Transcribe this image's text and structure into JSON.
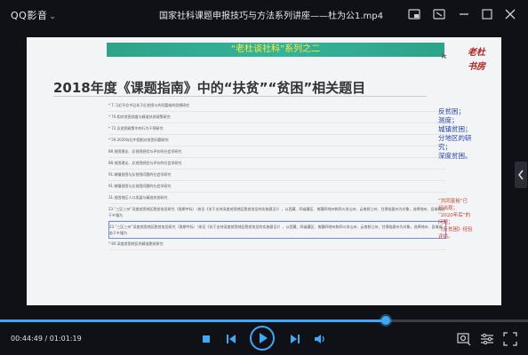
{
  "app": {
    "brand": "QQ影音",
    "window_title": "国家社科课题申报技巧与方法系列讲座——杜为公1.mp4"
  },
  "slide": {
    "banner": "“老杜谈社科”系列之二",
    "logo_text": "老杜书房",
    "heading": "2018年度《课题指南》中的“扶贫”“贫困”相关题目",
    "items": [
      "* 7.习近平总书记关于反贫困与共同富裕的思想研究",
      "* 70.相对贫困测度与精准扶贫政策研究",
      "* 72.反贫困政策中的行为干预研究",
      "* 59.2020年后中国相对贫困问题研究",
      "88.贫困理论、反贫困经验与评价的社会学研究",
      "88.贫困理论、反贫困经验与评价的社会学研究",
      "91.城镇贫困与反贫困问题的社会学研究",
      "91.城镇贫困与反贫困问题的社会学研究",
      "31.贫困地区人口发展与精准扶贫研究",
      "23.“三区三州”深度贫困地区脱贫攻坚研究（限期中标）（参见《关于支持深度贫困地区脱贫攻坚的实施意见》），以西藏、四省藏区、南疆四地州和四川凉山州、云南怒江州、甘肃临夏州为对象，选择地州、县域或若干乡镇为",
      "23.“三区三州”深度贫困地区脱贫攻坚研究（限期中标）（参见《关于支持深度贫困地区脱贫攻坚的实施意见》），以西藏、四省藏区、南疆四地州和四川凉山州、云南怒江州、甘肃临夏州为对象，选择地州、县域或若干乡镇为",
      "* 80.深度贫困地区的精准脱贫研究"
    ],
    "notes_blue": [
      "反贫困；",
      "测度；",
      "城镇贫困；",
      "分地区的研",
      "究；",
      "深度贫困。"
    ],
    "notes_red": [
      "“共同富裕”已",
      "经出现；",
      "“2020年后”的",
      "问题；",
      "《反贫困》经验",
      "评估。"
    ]
  },
  "player": {
    "time_current": "00:44:49",
    "time_separator": "/",
    "time_total": "01:01:19",
    "progress": 0.731,
    "accent": "#3fa9f5"
  }
}
